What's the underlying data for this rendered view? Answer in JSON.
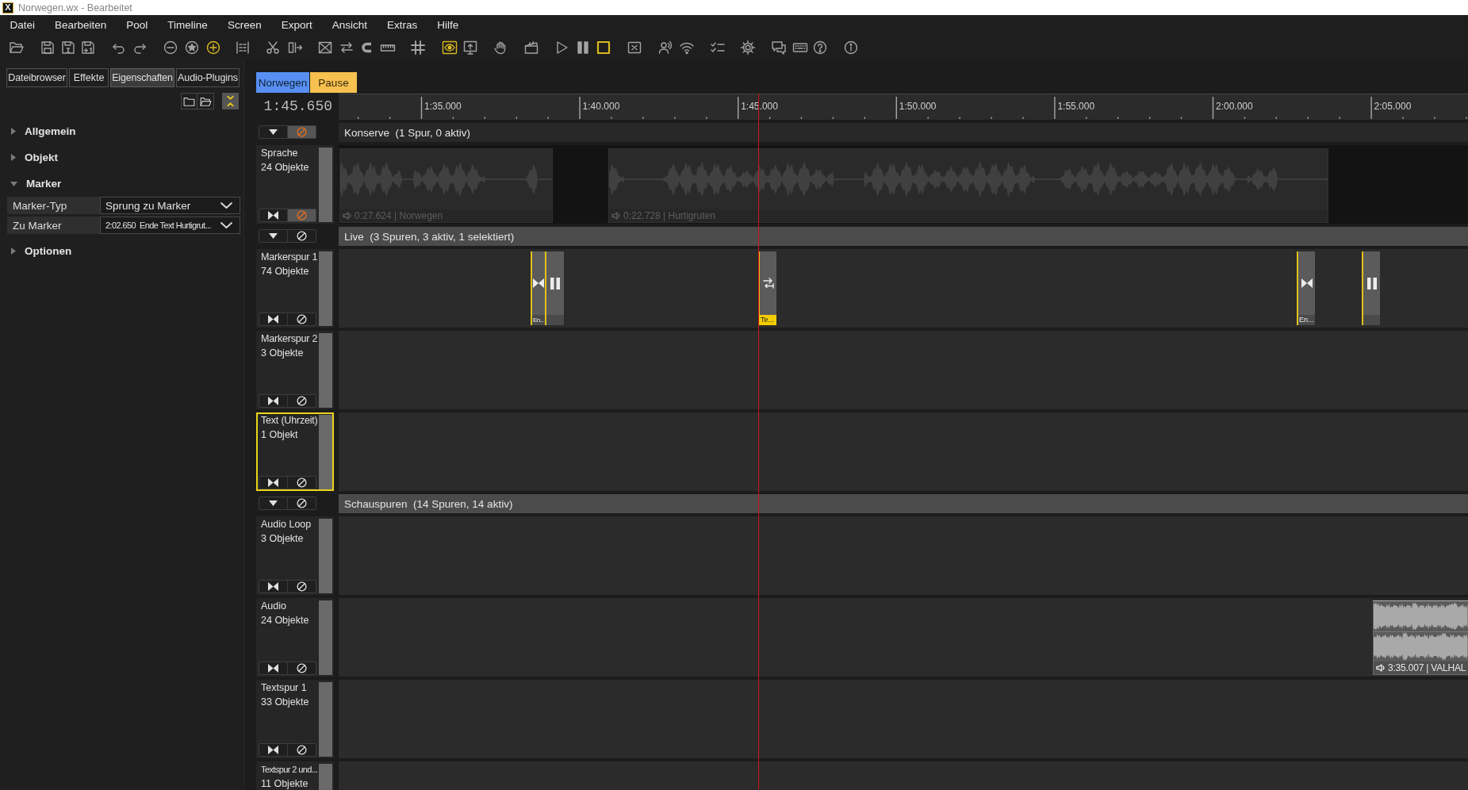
{
  "window": {
    "logo": "X",
    "title": "Norwegen.wx - Bearbeitet"
  },
  "menu": [
    "Datei",
    "Bearbeiten",
    "Pool",
    "Timeline",
    "Screen",
    "Export",
    "Ansicht",
    "Extras",
    "Hilfe"
  ],
  "toolbar": [
    {
      "active": false
    },
    {
      "active": false
    },
    {
      "active": false
    },
    {
      "active": false
    },
    {
      "active": false
    },
    {
      "active": false
    },
    {
      "active": false
    },
    {
      "active": false
    },
    {
      "active": true
    },
    {
      "active": false
    },
    {
      "active": false
    },
    {
      "active": false
    },
    {
      "active": false
    },
    {
      "active": false
    },
    {
      "active": false
    },
    {
      "active": false
    },
    {
      "active": false
    },
    {
      "active": true
    },
    {
      "active": false
    },
    {
      "active": false
    },
    {
      "active": false
    },
    {
      "active": false
    },
    {
      "active": false
    },
    {
      "active": true
    },
    {
      "active": false
    },
    {
      "active": false
    },
    {
      "active": false
    },
    {
      "active": false
    },
    {
      "active": false
    },
    {
      "active": false
    },
    {
      "active": false
    },
    {
      "active": false
    },
    {
      "active": false
    }
  ],
  "side_panel": {
    "tabs": [
      {
        "label": "Dateibrowser",
        "selected": false
      },
      {
        "label": "Effekte",
        "selected": false
      },
      {
        "label": "Eigenschaften",
        "selected": true
      },
      {
        "label": "Audio-Plugins",
        "selected": false
      }
    ],
    "sections": [
      {
        "title": "Allgemein",
        "expanded": false
      },
      {
        "title": "Objekt",
        "expanded": false
      },
      {
        "title": "Marker",
        "expanded": true,
        "properties": [
          {
            "label": "Marker-Typ",
            "value": "Sprung zu Marker"
          },
          {
            "label": "Zu Marker",
            "value": "2:02.650  Ende Text Hurtigrut..."
          }
        ]
      },
      {
        "title": "Optionen",
        "expanded": false
      }
    ]
  },
  "scenes": [
    {
      "label": "Norwegen",
      "color": "#5790f2"
    },
    {
      "label": "Pause",
      "color": "#f7c14f"
    }
  ],
  "timeline": {
    "position": "1:45.650",
    "ruler": [
      "1:35.000",
      "1:40.000",
      "1:45.000",
      "1:50.000",
      "1:55.000",
      "2:00.000",
      "2:05.000"
    ],
    "groups": [
      {
        "title": "Konserve  (1 Spur, 0 aktiv)",
        "expanded": true,
        "muted": true,
        "tracks": [
          {
            "name": "Sprache",
            "count": "24 Objekte",
            "muted": true,
            "selected": false,
            "clips": [
              {
                "kind": "audio",
                "label": "0:27.624 | Norwegen"
              },
              {
                "kind": "audio",
                "label": "0:22.728 | Hurtigruten"
              }
            ]
          }
        ]
      },
      {
        "title": "Live  (3 Spuren, 3 aktiv, 1 selektiert)",
        "expanded": true,
        "muted": false,
        "tracks": [
          {
            "name": "Markerspur 1",
            "count": "74 Objekte",
            "muted": false,
            "selected": false,
            "markers": [
              {
                "kind": "end",
                "label": "En...",
                "selected": false
              },
              {
                "kind": "pause",
                "selected": false
              },
              {
                "kind": "jump",
                "label": "Te...",
                "selected": true
              },
              {
                "kind": "end",
                "label": "En...",
                "selected": false
              },
              {
                "kind": "pause",
                "selected": false
              }
            ]
          },
          {
            "name": "Markerspur 2",
            "count": "3 Objekte",
            "muted": false,
            "selected": false
          },
          {
            "name": "Text (Uhrzeit)",
            "count": "1 Objekt",
            "muted": false,
            "selected": true
          }
        ]
      },
      {
        "title": "Schauspuren  (14 Spuren, 14 aktiv)",
        "expanded": true,
        "muted": false,
        "tracks": [
          {
            "name": "Audio Loop",
            "count": "3 Objekte",
            "muted": false,
            "selected": false
          },
          {
            "name": "Audio",
            "count": "24 Objekte",
            "muted": false,
            "selected": false,
            "clips": [
              {
                "kind": "audio",
                "label": "3:35.007 | VALHAL"
              }
            ]
          },
          {
            "name": "Textspur 1",
            "count": "33 Objekte",
            "muted": false,
            "selected": false
          },
          {
            "name": "Textspur 2 und...",
            "count": "11 Objekte",
            "selected": false
          }
        ]
      }
    ]
  }
}
